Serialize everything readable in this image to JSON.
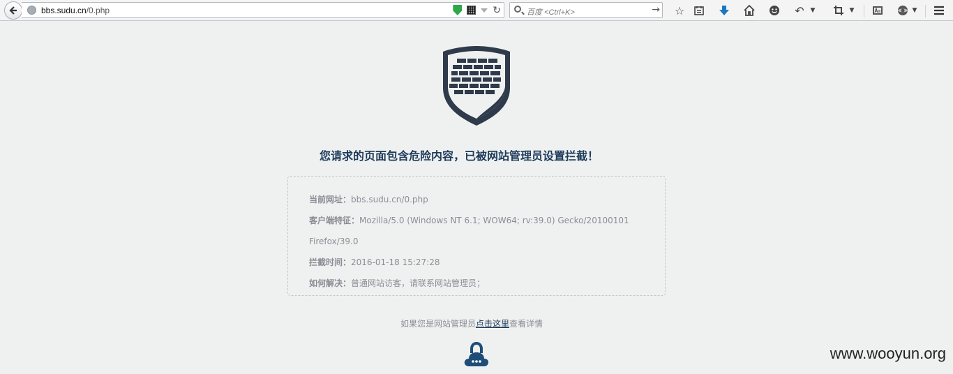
{
  "browser": {
    "url_host": "bbs.sudu.cn",
    "url_path": "/0.php",
    "search_placeholder": "百度 <Ctrl+K>",
    "icons": [
      "back-arrow-icon",
      "globe-icon",
      "shield-icon",
      "qr-code-icon",
      "dropdown-icon",
      "reload-icon",
      "search-icon",
      "go-arrow-icon",
      "star-icon",
      "reading-list-icon",
      "download-icon",
      "home-icon",
      "smiley-icon",
      "undo-icon",
      "crop-icon",
      "reader-mode-icon",
      "addon-icon",
      "menu-icon"
    ]
  },
  "page": {
    "headline": "您请求的页面包含危险内容，已被网站管理员设置拦截！",
    "info": {
      "url_label": "当前网址：",
      "url_value": "bbs.sudu.cn/0.php",
      "ua_label": "客户端特征：",
      "ua_value_1": "Mozilla/5.0 (Windows NT 6.1; WOW64; rv:39.0) Gecko/20100101",
      "ua_value_2": "Firefox/39.0",
      "time_label": "拦截时间：",
      "time_value": "2016-01-18 15:27:28",
      "solve_label": "如何解决：",
      "solve_value": "普通网站访客，请联系网站管理员；"
    },
    "admin_prefix": "如果您是网站管理员",
    "admin_link": "点击这里",
    "admin_suffix": "查看详情"
  },
  "watermark": "www.wooyun.org",
  "colors": {
    "background": "#eff1f1",
    "headline": "#1e3b5a",
    "shield_dark": "#2f3a4a",
    "lock_blue": "#1e4d78",
    "text_gray": "#8a8e93"
  }
}
